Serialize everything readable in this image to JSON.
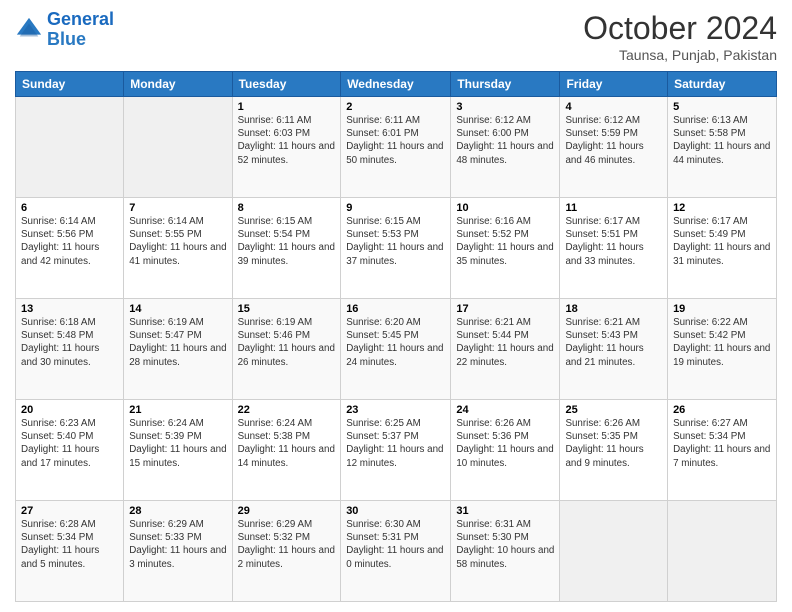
{
  "header": {
    "logo_line1": "General",
    "logo_line2": "Blue",
    "month": "October 2024",
    "location": "Taunsa, Punjab, Pakistan"
  },
  "days_of_week": [
    "Sunday",
    "Monday",
    "Tuesday",
    "Wednesday",
    "Thursday",
    "Friday",
    "Saturday"
  ],
  "weeks": [
    [
      {
        "day": "",
        "info": ""
      },
      {
        "day": "",
        "info": ""
      },
      {
        "day": "1",
        "info": "Sunrise: 6:11 AM\nSunset: 6:03 PM\nDaylight: 11 hours and 52 minutes."
      },
      {
        "day": "2",
        "info": "Sunrise: 6:11 AM\nSunset: 6:01 PM\nDaylight: 11 hours and 50 minutes."
      },
      {
        "day": "3",
        "info": "Sunrise: 6:12 AM\nSunset: 6:00 PM\nDaylight: 11 hours and 48 minutes."
      },
      {
        "day": "4",
        "info": "Sunrise: 6:12 AM\nSunset: 5:59 PM\nDaylight: 11 hours and 46 minutes."
      },
      {
        "day": "5",
        "info": "Sunrise: 6:13 AM\nSunset: 5:58 PM\nDaylight: 11 hours and 44 minutes."
      }
    ],
    [
      {
        "day": "6",
        "info": "Sunrise: 6:14 AM\nSunset: 5:56 PM\nDaylight: 11 hours and 42 minutes."
      },
      {
        "day": "7",
        "info": "Sunrise: 6:14 AM\nSunset: 5:55 PM\nDaylight: 11 hours and 41 minutes."
      },
      {
        "day": "8",
        "info": "Sunrise: 6:15 AM\nSunset: 5:54 PM\nDaylight: 11 hours and 39 minutes."
      },
      {
        "day": "9",
        "info": "Sunrise: 6:15 AM\nSunset: 5:53 PM\nDaylight: 11 hours and 37 minutes."
      },
      {
        "day": "10",
        "info": "Sunrise: 6:16 AM\nSunset: 5:52 PM\nDaylight: 11 hours and 35 minutes."
      },
      {
        "day": "11",
        "info": "Sunrise: 6:17 AM\nSunset: 5:51 PM\nDaylight: 11 hours and 33 minutes."
      },
      {
        "day": "12",
        "info": "Sunrise: 6:17 AM\nSunset: 5:49 PM\nDaylight: 11 hours and 31 minutes."
      }
    ],
    [
      {
        "day": "13",
        "info": "Sunrise: 6:18 AM\nSunset: 5:48 PM\nDaylight: 11 hours and 30 minutes."
      },
      {
        "day": "14",
        "info": "Sunrise: 6:19 AM\nSunset: 5:47 PM\nDaylight: 11 hours and 28 minutes."
      },
      {
        "day": "15",
        "info": "Sunrise: 6:19 AM\nSunset: 5:46 PM\nDaylight: 11 hours and 26 minutes."
      },
      {
        "day": "16",
        "info": "Sunrise: 6:20 AM\nSunset: 5:45 PM\nDaylight: 11 hours and 24 minutes."
      },
      {
        "day": "17",
        "info": "Sunrise: 6:21 AM\nSunset: 5:44 PM\nDaylight: 11 hours and 22 minutes."
      },
      {
        "day": "18",
        "info": "Sunrise: 6:21 AM\nSunset: 5:43 PM\nDaylight: 11 hours and 21 minutes."
      },
      {
        "day": "19",
        "info": "Sunrise: 6:22 AM\nSunset: 5:42 PM\nDaylight: 11 hours and 19 minutes."
      }
    ],
    [
      {
        "day": "20",
        "info": "Sunrise: 6:23 AM\nSunset: 5:40 PM\nDaylight: 11 hours and 17 minutes."
      },
      {
        "day": "21",
        "info": "Sunrise: 6:24 AM\nSunset: 5:39 PM\nDaylight: 11 hours and 15 minutes."
      },
      {
        "day": "22",
        "info": "Sunrise: 6:24 AM\nSunset: 5:38 PM\nDaylight: 11 hours and 14 minutes."
      },
      {
        "day": "23",
        "info": "Sunrise: 6:25 AM\nSunset: 5:37 PM\nDaylight: 11 hours and 12 minutes."
      },
      {
        "day": "24",
        "info": "Sunrise: 6:26 AM\nSunset: 5:36 PM\nDaylight: 11 hours and 10 minutes."
      },
      {
        "day": "25",
        "info": "Sunrise: 6:26 AM\nSunset: 5:35 PM\nDaylight: 11 hours and 9 minutes."
      },
      {
        "day": "26",
        "info": "Sunrise: 6:27 AM\nSunset: 5:34 PM\nDaylight: 11 hours and 7 minutes."
      }
    ],
    [
      {
        "day": "27",
        "info": "Sunrise: 6:28 AM\nSunset: 5:34 PM\nDaylight: 11 hours and 5 minutes."
      },
      {
        "day": "28",
        "info": "Sunrise: 6:29 AM\nSunset: 5:33 PM\nDaylight: 11 hours and 3 minutes."
      },
      {
        "day": "29",
        "info": "Sunrise: 6:29 AM\nSunset: 5:32 PM\nDaylight: 11 hours and 2 minutes."
      },
      {
        "day": "30",
        "info": "Sunrise: 6:30 AM\nSunset: 5:31 PM\nDaylight: 11 hours and 0 minutes."
      },
      {
        "day": "31",
        "info": "Sunrise: 6:31 AM\nSunset: 5:30 PM\nDaylight: 10 hours and 58 minutes."
      },
      {
        "day": "",
        "info": ""
      },
      {
        "day": "",
        "info": ""
      }
    ]
  ]
}
